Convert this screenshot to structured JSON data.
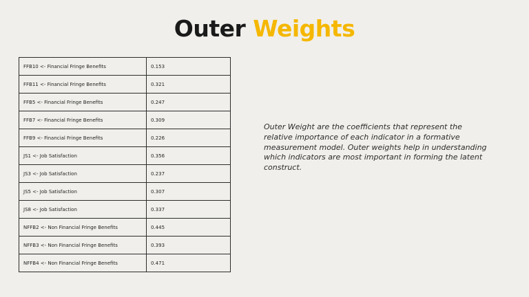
{
  "title": {
    "part1": "Outer",
    "part2": "Weights"
  },
  "table": {
    "rows": [
      {
        "indicator": "FFB10 <- Financial Fringe Benefits",
        "weight": "0.153"
      },
      {
        "indicator": "FFB11 <- Financial Fringe Benefits",
        "weight": "0.321"
      },
      {
        "indicator": "FFB5 <- Financial Fringe Benefits",
        "weight": "0.247"
      },
      {
        "indicator": "FFB7 <- Financial Fringe Benefits",
        "weight": "0.309"
      },
      {
        "indicator": "FFB9 <- Financial Fringe Benefits",
        "weight": "0.226"
      },
      {
        "indicator": "JS1 <- Job Satisfaction",
        "weight": "0.356"
      },
      {
        "indicator": "JS3 <- Job Satisfaction",
        "weight": "0.237"
      },
      {
        "indicator": "JS5 <- Job Satisfaction",
        "weight": "0.307"
      },
      {
        "indicator": "JS8 <- Job Satisfaction",
        "weight": "0.337"
      },
      {
        "indicator": "NFFB2 <- Non Financial Fringe Benefits",
        "weight": "0.445"
      },
      {
        "indicator": "NFFB3 <- Non Financial Fringe Benefits",
        "weight": "0.393"
      },
      {
        "indicator": "NFFB4 <- Non Financial Fringe Benefits",
        "weight": "0.471"
      }
    ]
  },
  "description": "Outer Weight are the coefficients that represent the relative importance of each indicator in a formative measurement model. Outer weights help in understanding which indicators are most important in forming the latent construct.",
  "colors": {
    "background": "#f0efeb",
    "title_dark": "#1a1a1a",
    "title_accent": "#f5b700",
    "border": "#2b2b2b"
  }
}
